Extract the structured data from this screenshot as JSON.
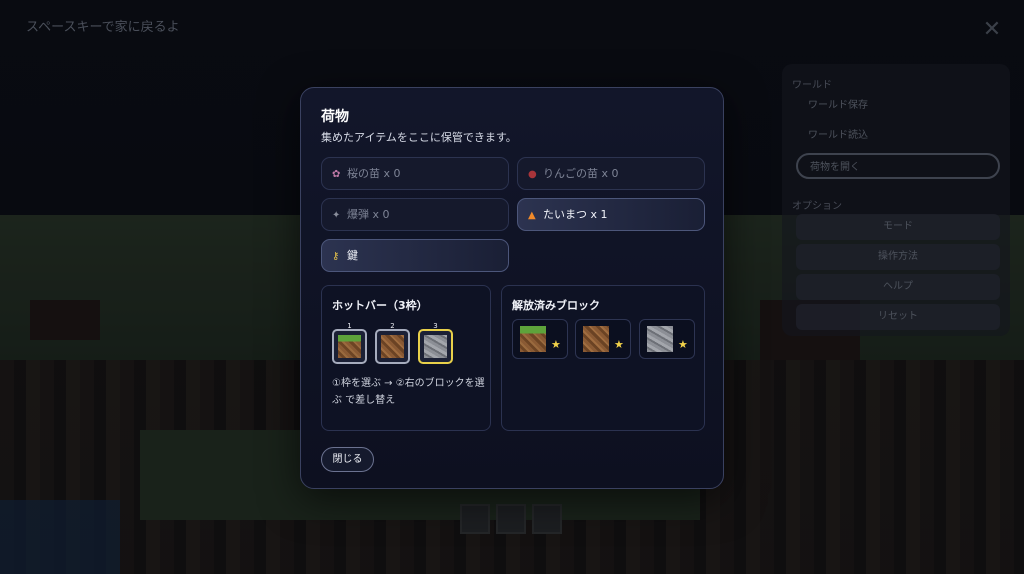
{
  "background": {
    "top_hint": "スペースキーで家に戻るよ",
    "side_menu": {
      "label_1": "ワールド",
      "items_1": [
        "ワールド保存",
        "ワールド読込",
        "荷物を開く"
      ],
      "label_2": "オプション",
      "items_2": [
        "モード",
        "操作方法",
        "ヘルプ",
        "リセット"
      ]
    }
  },
  "modal": {
    "title": "荷物",
    "description": "集めたアイテムをここに保管できます。",
    "items": [
      {
        "icon": "sakura-icon",
        "glyph": "✿",
        "label": "桜の苗 x 0",
        "owned": false
      },
      {
        "icon": "apple-icon",
        "glyph": "●",
        "label": "りんごの苗 x 0",
        "owned": false
      },
      {
        "icon": "bomb-icon",
        "glyph": "✦",
        "label": "爆弾 x 0",
        "owned": false
      },
      {
        "icon": "fire-icon",
        "glyph": "🔥",
        "label": "たいまつ x 1",
        "owned": true
      },
      {
        "icon": "key-icon",
        "glyph": "🔑",
        "label": "鍵",
        "owned": true
      }
    ],
    "hotbar": {
      "title": "ホットバー（3枠）",
      "slots": [
        {
          "number": "1",
          "block": "grass"
        },
        {
          "number": "2",
          "block": "dirt"
        },
        {
          "number": "3",
          "block": "stone",
          "selected": true
        }
      ],
      "hint": "①枠を選ぶ → ②右のブロックを選ぶ で差し替え"
    },
    "unlocked": {
      "title": "解放済みブロック",
      "blocks": [
        "grass",
        "dirt",
        "stone"
      ]
    },
    "close_label": "閉じる"
  }
}
